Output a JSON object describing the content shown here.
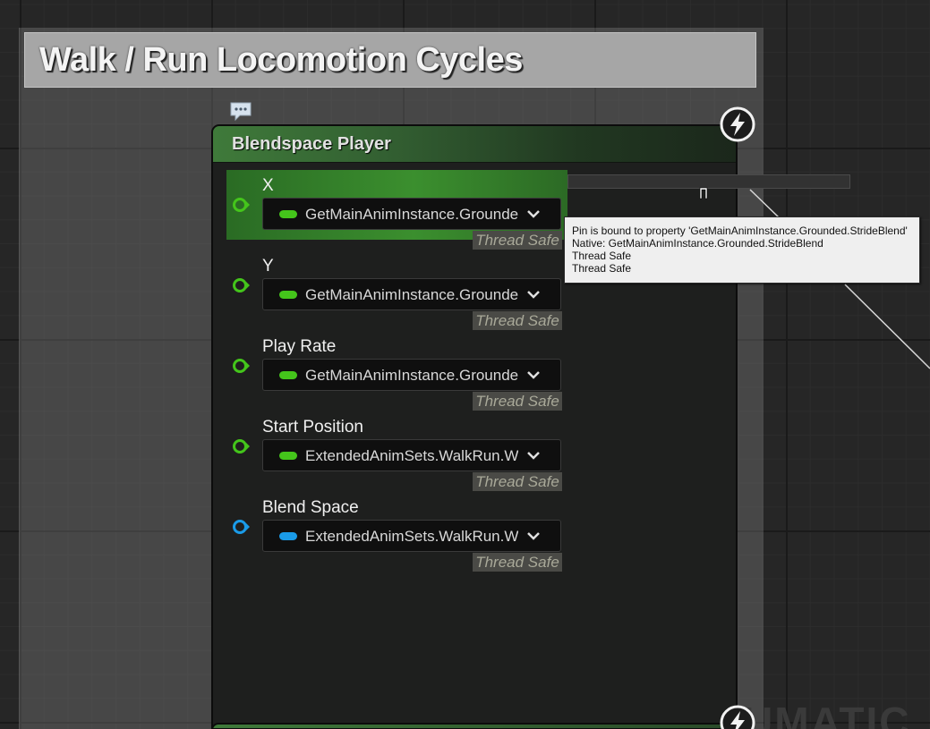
{
  "comment": {
    "title": "Walk / Run Locomotion Cycles"
  },
  "node": {
    "title": "Blendspace Player",
    "header_color": "#3f7a3a"
  },
  "pins": [
    {
      "label": "X",
      "value": "GetMainAnimInstance.Grounded.StrideBlend",
      "badge": "Thread Safe",
      "pin_color": "#44c51b",
      "highlighted": true
    },
    {
      "label": "Y",
      "value": "GetMainAnimInstance.Grounded",
      "badge": "Thread Safe",
      "pin_color": "#44c51b",
      "highlighted": false
    },
    {
      "label": "Play Rate",
      "value": "GetMainAnimInstance.Grounded",
      "badge": "Thread Safe",
      "pin_color": "#44c51b",
      "highlighted": false
    },
    {
      "label": "Start Position",
      "value": "ExtendedAnimSets.WalkRun.W",
      "badge": "Thread Safe",
      "pin_color": "#44c51b",
      "highlighted": false
    },
    {
      "label": "Blend Space",
      "value": "ExtendedAnimSets.WalkRun.W",
      "badge": "Thread Safe",
      "pin_color": "#1a9be8",
      "highlighted": false
    }
  ],
  "tooltip": {
    "lines": [
      "Pin is bound to property 'GetMainAnimInstance.Grounded.StrideBlend'",
      "Native: GetMainAnimInstance.Grounded.StrideBlend",
      "Thread Safe",
      "Thread Safe"
    ]
  },
  "icons": {
    "comment_bubble": "comment-bubble-icon",
    "thread_safety": "lightning-icon",
    "dropdown": "chevron-down-icon",
    "pin": "pin-circle-icon"
  },
  "watermark": {
    "text": "UMATIC"
  },
  "colors": {
    "float_pin": "#44c51b",
    "object_pin": "#1a9be8",
    "graph_bg": "#262626"
  }
}
